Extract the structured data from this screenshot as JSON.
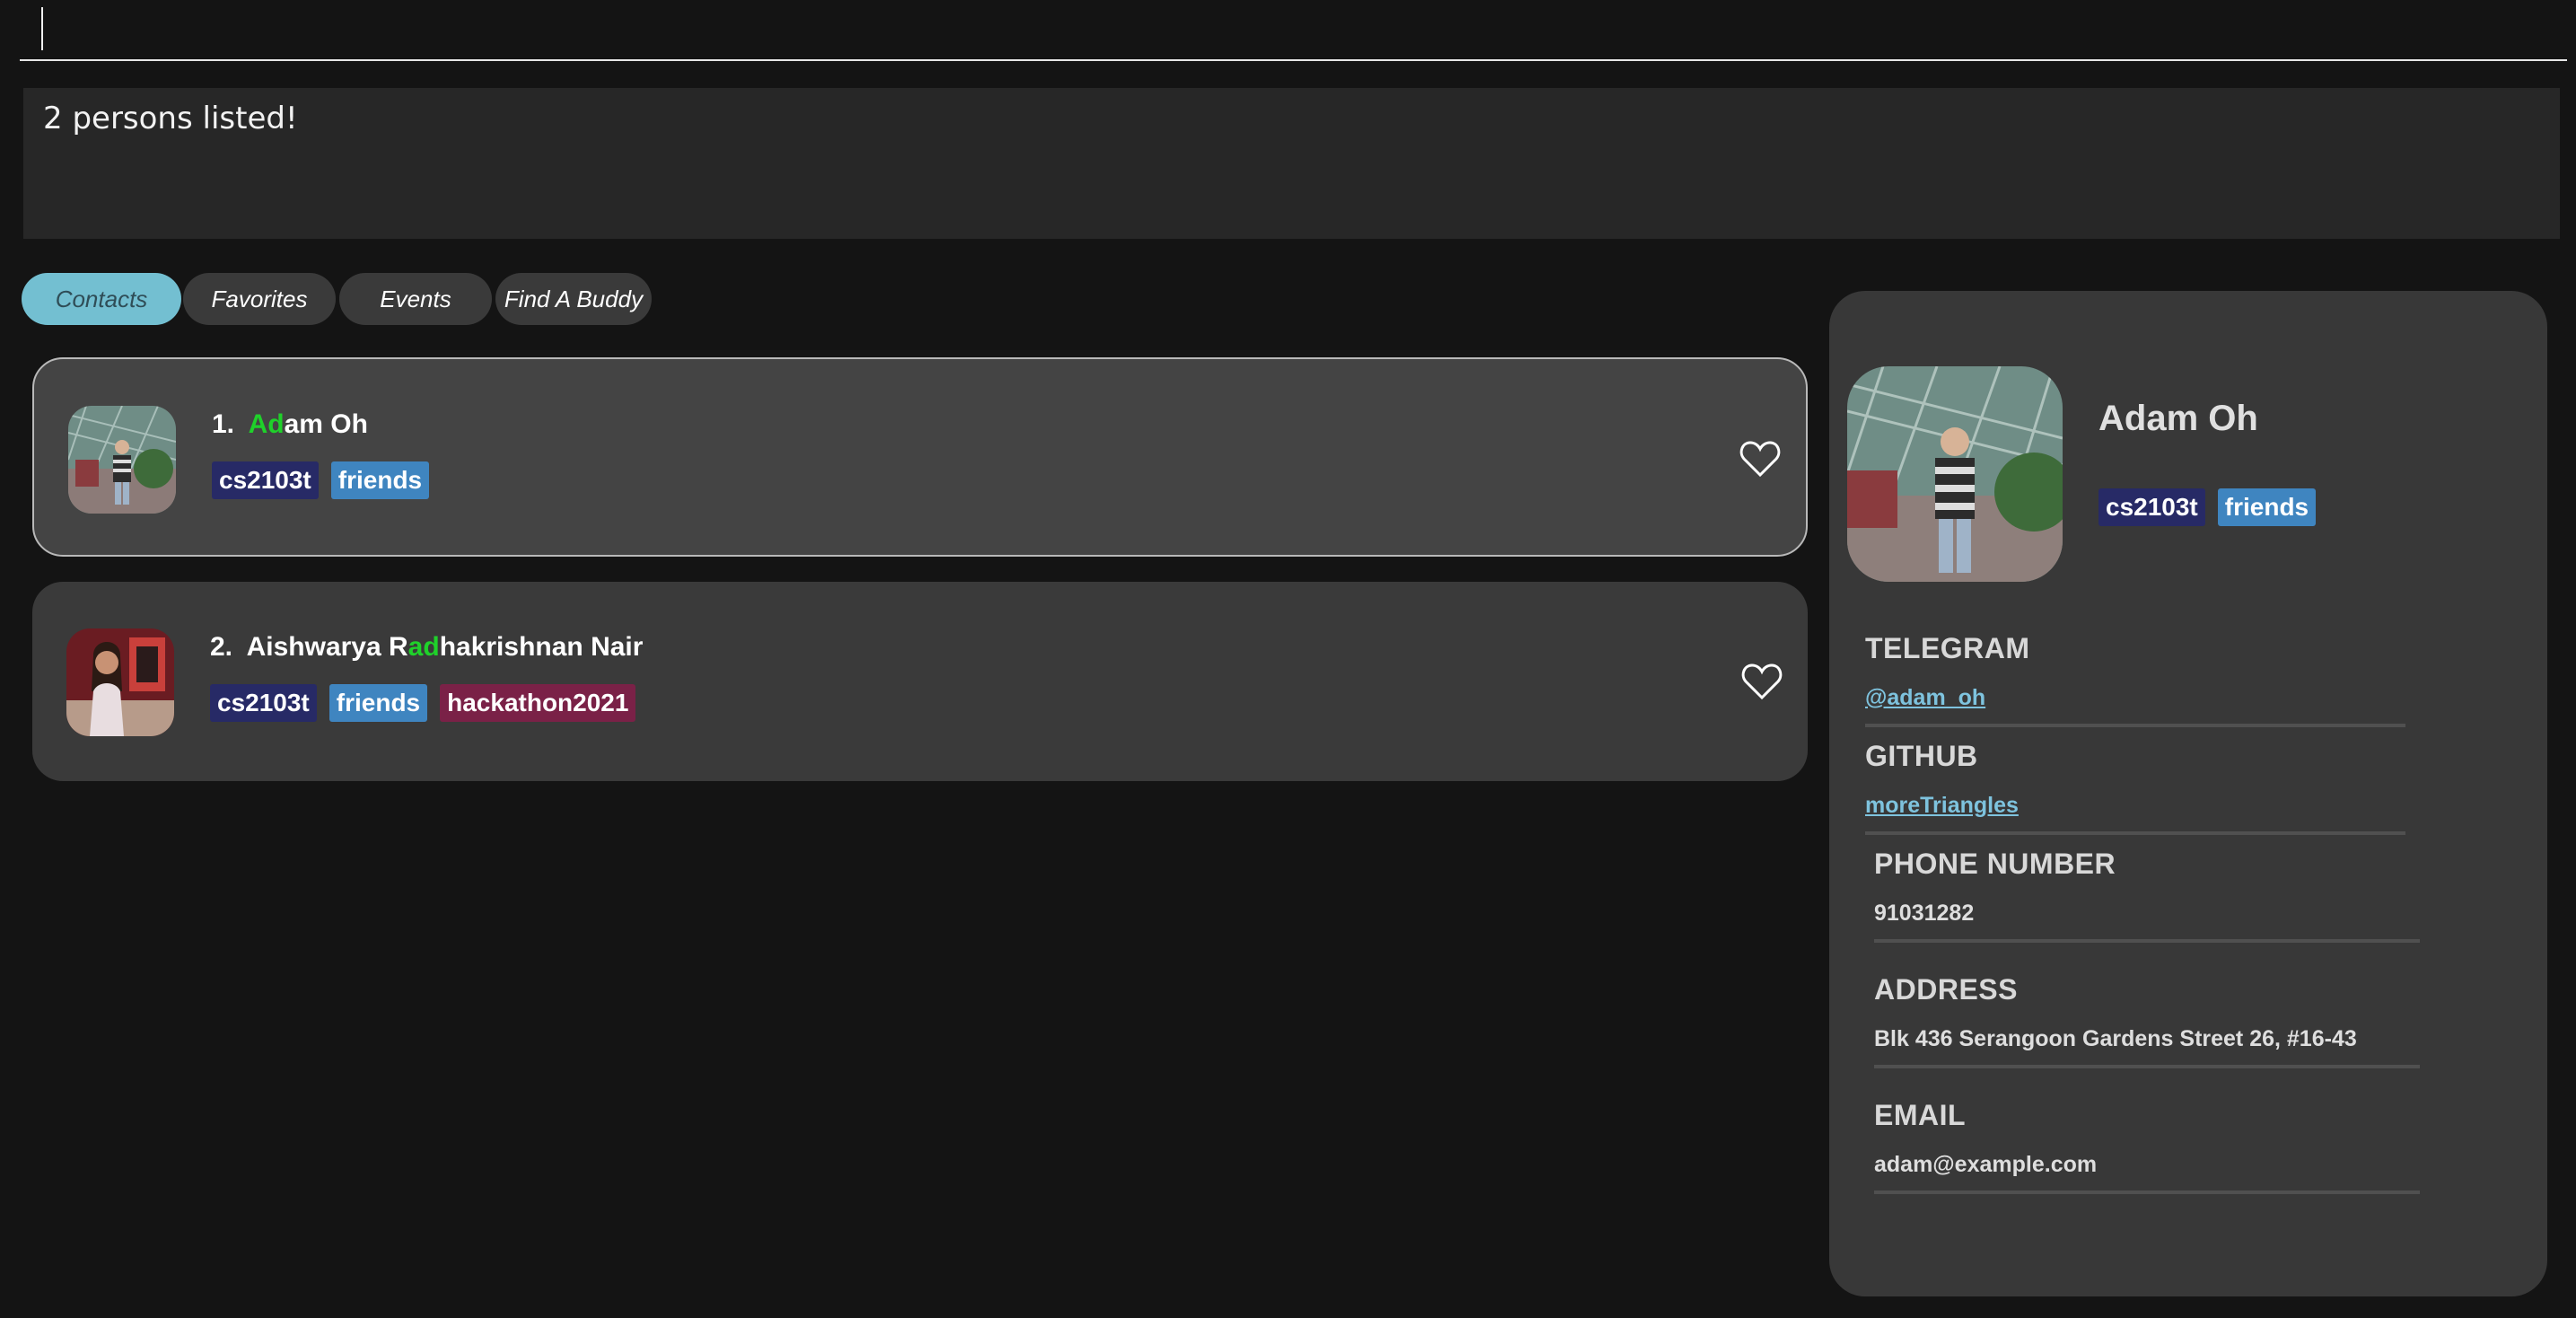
{
  "command": {
    "value": "",
    "placeholder": ""
  },
  "result": {
    "message": "2 persons listed!"
  },
  "tabs": [
    {
      "label": "Contacts",
      "active": true
    },
    {
      "label": "Favorites",
      "active": false
    },
    {
      "label": "Events",
      "active": false
    },
    {
      "label": "Find A Buddy",
      "active": false
    }
  ],
  "persons": [
    {
      "index": "1.",
      "name_pre": "",
      "name_hl": "Ad",
      "name_post": "am Oh",
      "tags": [
        "cs2103t",
        "friends"
      ],
      "favorite_icon": "heart-outline-icon"
    },
    {
      "index": "2.",
      "name_pre": "Aishwarya R",
      "name_hl": "ad",
      "name_post": "hakrishnan Nair",
      "tags": [
        "cs2103t",
        "friends",
        "hackathon2021"
      ],
      "favorite_icon": "heart-outline-icon"
    }
  ],
  "detail": {
    "name": "Adam Oh",
    "tags": [
      "cs2103t",
      "friends"
    ],
    "fields": {
      "telegram": {
        "label": "TELEGRAM",
        "value": "@adam_oh"
      },
      "github": {
        "label": "GITHUB",
        "value": "moreTriangles"
      },
      "phone": {
        "label": "PHONE NUMBER",
        "value": "91031282"
      },
      "address": {
        "label": "ADDRESS",
        "value": "Blk 436 Serangoon Gardens Street 26, #16-43"
      },
      "email": {
        "label": "EMAIL",
        "value": "adam@example.com"
      }
    }
  },
  "colors": {
    "background": "#141414",
    "card": "#3a3a3a",
    "tab_active": "#73bfd1",
    "highlight": "#1fd12a",
    "tag_cs2103t": "#272a66",
    "tag_friends": "#3f85c0",
    "tag_hackathon2021": "#7a2147",
    "link": "#7ec3de"
  }
}
